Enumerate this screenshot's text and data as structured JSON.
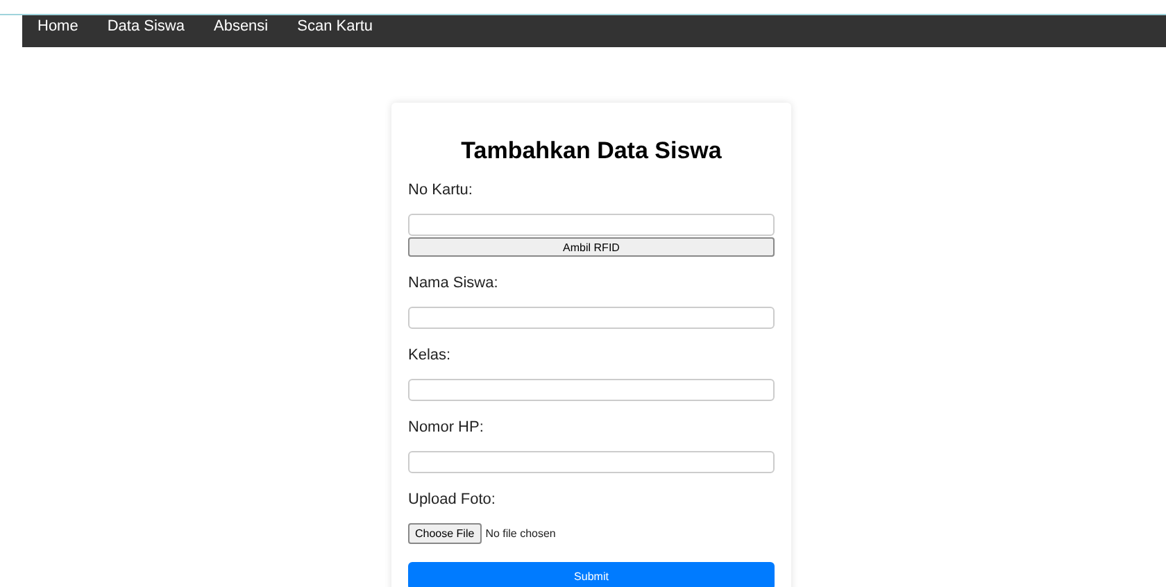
{
  "nav": {
    "items": [
      "Home",
      "Data Siswa",
      "Absensi",
      "Scan Kartu"
    ]
  },
  "form": {
    "title": "Tambahkan Data Siswa",
    "fields": [
      {
        "kind": "rfid",
        "label": "No Kartu:",
        "button": "Ambil RFID"
      },
      {
        "kind": "text",
        "label": "Nama Siswa:"
      },
      {
        "kind": "text",
        "label": "Kelas:"
      },
      {
        "kind": "text",
        "label": "Nomor HP:"
      },
      {
        "kind": "file",
        "label": "Upload Foto:",
        "button": "Choose File",
        "status": "No file chosen"
      }
    ],
    "submit": "Submit"
  }
}
